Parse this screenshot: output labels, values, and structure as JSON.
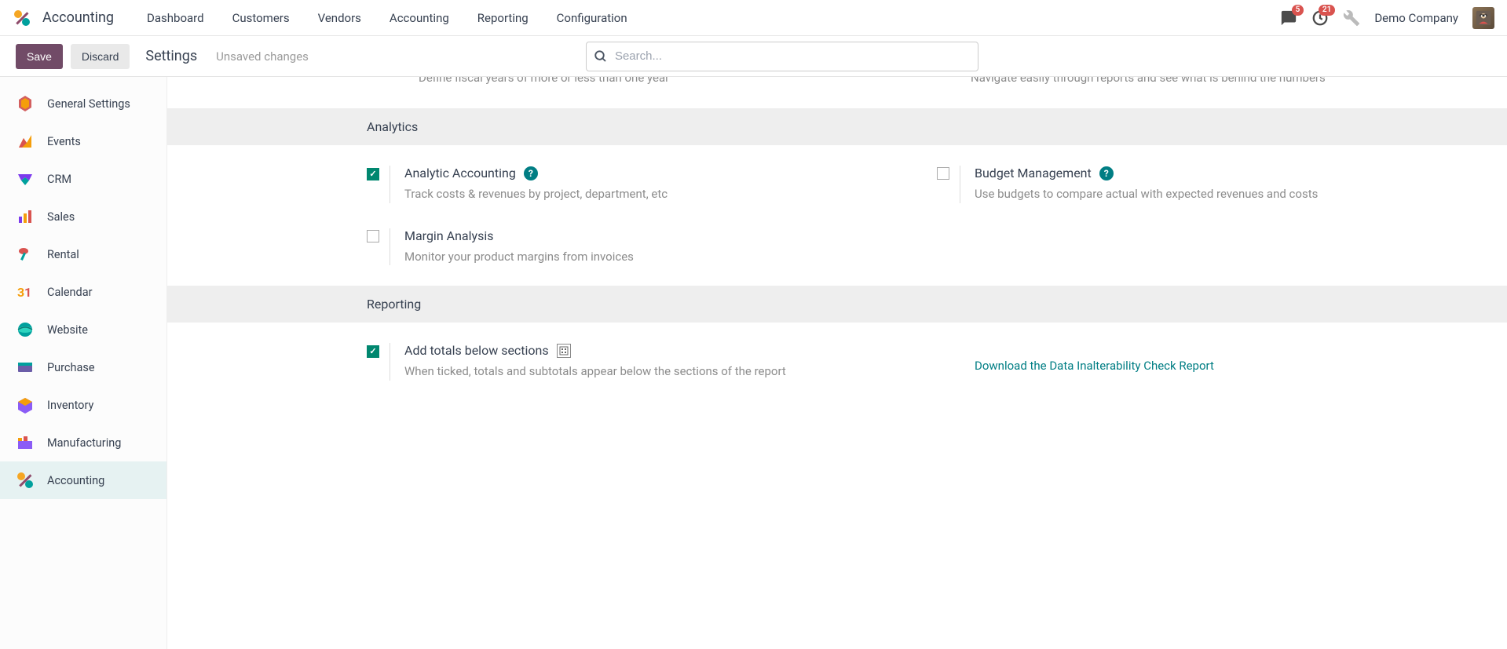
{
  "header": {
    "app_name": "Accounting",
    "nav": [
      "Dashboard",
      "Customers",
      "Vendors",
      "Accounting",
      "Reporting",
      "Configuration"
    ],
    "msg_badge": "5",
    "activity_badge": "21",
    "company": "Demo Company"
  },
  "controlbar": {
    "save": "Save",
    "discard": "Discard",
    "breadcrumb": "Settings",
    "status": "Unsaved changes",
    "search_placeholder": "Search..."
  },
  "sidebar": {
    "items": [
      {
        "label": "General Settings"
      },
      {
        "label": "Events"
      },
      {
        "label": "CRM"
      },
      {
        "label": "Sales"
      },
      {
        "label": "Rental"
      },
      {
        "label": "Calendar"
      },
      {
        "label": "Website"
      },
      {
        "label": "Purchase"
      },
      {
        "label": "Inventory"
      },
      {
        "label": "Manufacturing"
      },
      {
        "label": "Accounting"
      }
    ]
  },
  "partial": {
    "left": "Define fiscal years of more or less than one year",
    "right": "Navigate easily through reports and see what is behind the numbers"
  },
  "sections": {
    "analytics": {
      "title": "Analytics",
      "opt1": {
        "title": "Analytic Accounting",
        "desc": "Track costs & revenues by project, department, etc"
      },
      "opt2": {
        "title": "Budget Management",
        "desc": "Use budgets to compare actual with expected revenues and costs"
      },
      "opt3": {
        "title": "Margin Analysis",
        "desc": "Monitor your product margins from invoices"
      }
    },
    "reporting": {
      "title": "Reporting",
      "opt1": {
        "title": "Add totals below sections",
        "desc": "When ticked, totals and subtotals appear below the sections of the report"
      },
      "link": "Download the Data Inalterability Check Report"
    }
  }
}
